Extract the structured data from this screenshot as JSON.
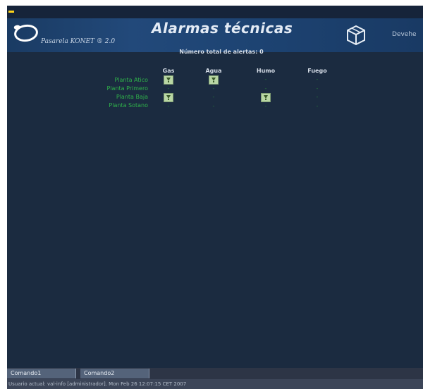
{
  "header": {
    "logo_text": "Pasarela KONET ® 2.0",
    "title": "Alarmas técnicas",
    "right_text": "Devehe"
  },
  "summary": {
    "alert_total": "Número total de alertas: 0"
  },
  "alarm_table": {
    "columns": [
      "Gas",
      "Agua",
      "Humo",
      "Fuego"
    ],
    "rows": [
      {
        "label": "Planta Atico",
        "cells": [
          "alarm-icon",
          "alarm-icon",
          "-",
          "-"
        ]
      },
      {
        "label": "Planta Primero",
        "cells": [
          "-",
          "-",
          "-",
          "-"
        ]
      },
      {
        "label": "Planta Baja",
        "cells": [
          "alarm-icon",
          "-",
          "alarm-icon",
          "-"
        ]
      },
      {
        "label": "Planta Sotano",
        "cells": [
          "-",
          "-",
          "-",
          "-"
        ]
      }
    ]
  },
  "commands": [
    {
      "label": "Comando1"
    },
    {
      "label": "Comando2"
    }
  ],
  "status_bar": {
    "text": "Usuario actual: val-info [administrador]. Mon Feb 26 12:07:15 CET 2007"
  },
  "colors": {
    "background": "#1b2b40",
    "header": "#22497a",
    "row_label": "#2fb24a",
    "alarm_icon": "#b9d7a4",
    "indicator": "#ffd51a"
  }
}
